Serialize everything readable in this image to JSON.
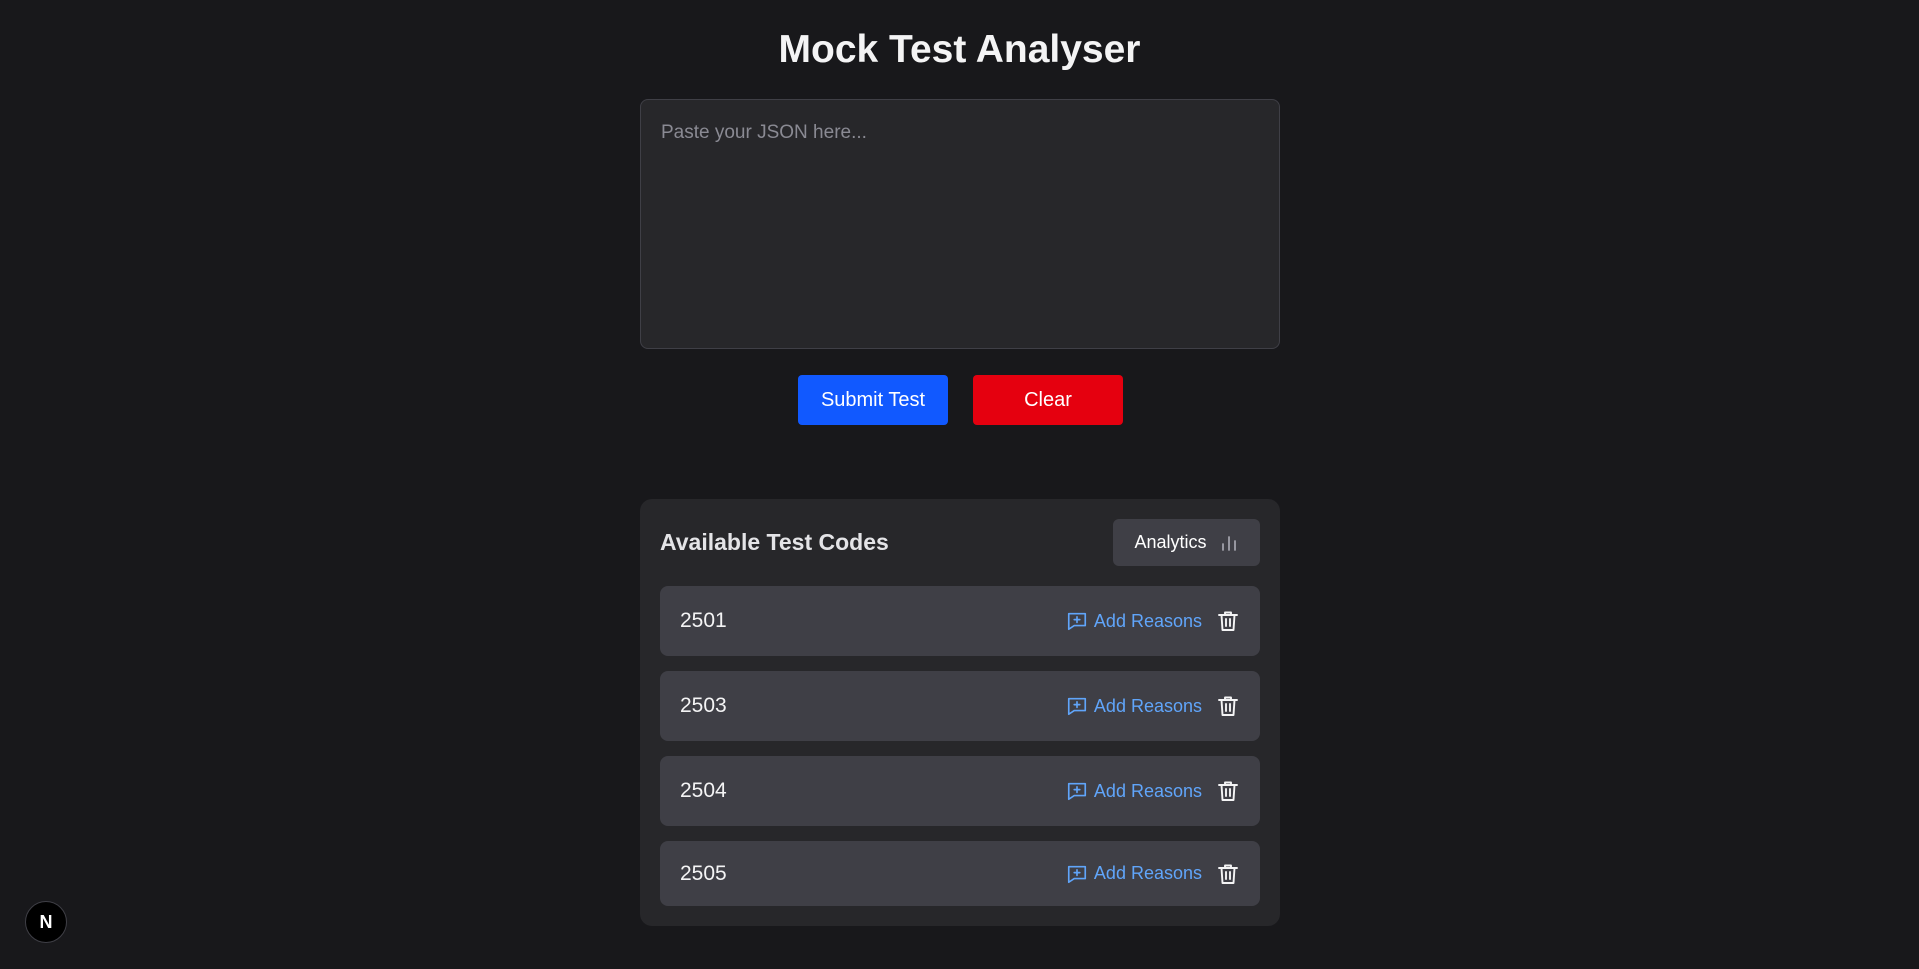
{
  "app": {
    "title": "Mock Test Analyser"
  },
  "json_input": {
    "placeholder": "Paste your JSON here...",
    "value": ""
  },
  "buttons": {
    "submit_label": "Submit Test",
    "clear_label": "Clear"
  },
  "tests_panel": {
    "title": "Available Test Codes",
    "analytics_label": "Analytics",
    "analytics_icon": "bar-chart-icon",
    "rows": [
      {
        "code": "2501",
        "add_reasons_label": "Add Reasons",
        "add_icon": "message-plus-icon",
        "delete_icon": "trash-icon"
      },
      {
        "code": "2503",
        "add_reasons_label": "Add Reasons",
        "add_icon": "message-plus-icon",
        "delete_icon": "trash-icon"
      },
      {
        "code": "2504",
        "add_reasons_label": "Add Reasons",
        "add_icon": "message-plus-icon",
        "delete_icon": "trash-icon"
      },
      {
        "code": "2505",
        "add_reasons_label": "Add Reasons",
        "add_icon": "message-plus-icon",
        "delete_icon": "trash-icon"
      }
    ]
  },
  "dev_badge": {
    "label": "N",
    "icon": "nextjs-logo-icon"
  },
  "colors": {
    "background": "#18181b",
    "panel": "#27272a",
    "row": "#3f3f46",
    "submit": "#1159ff",
    "clear": "#e5000f",
    "link": "#60a5fa"
  }
}
